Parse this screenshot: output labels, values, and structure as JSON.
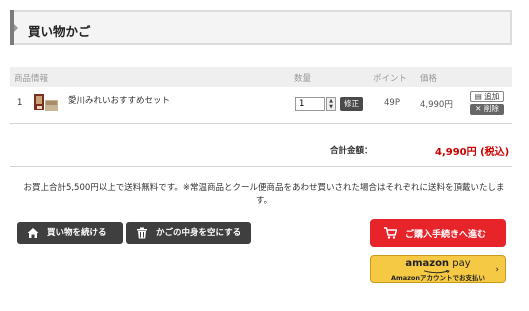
{
  "header": {
    "title": "買い物かご"
  },
  "table": {
    "columns": {
      "product": "商品情報",
      "quantity": "数量",
      "points": "ポイント",
      "price": "価格"
    },
    "rows": [
      {
        "index": "1",
        "name": "愛川みれいおすすめセット",
        "quantity": "1",
        "update_label": "修正",
        "points": "49P",
        "price": "4,990円",
        "add_label": "追加",
        "delete_label": "削除"
      }
    ]
  },
  "summary": {
    "total_label": "合計金額：",
    "total_value": "4,990円 (税込)"
  },
  "notice": "お買上合計5,500円以上で送料無料です。※常温商品とクール便商品をあわせ買いされた場合はそれぞれに送料を頂戴いたします。",
  "buttons": {
    "continue_shopping": "買い物を続ける",
    "empty_cart": "かごの中身を空にする",
    "checkout": "ご購入手続きへ進む",
    "amazon_pay_logo_left": "amazon",
    "amazon_pay_logo_right": "pay",
    "amazon_pay_sub": "Amazonアカウントでお支払い"
  },
  "colors": {
    "accent_red": "#cc0000",
    "checkout_red": "#e8242b",
    "amazon_yellow": "#f6c944",
    "dark_button": "#3f3f3f"
  }
}
